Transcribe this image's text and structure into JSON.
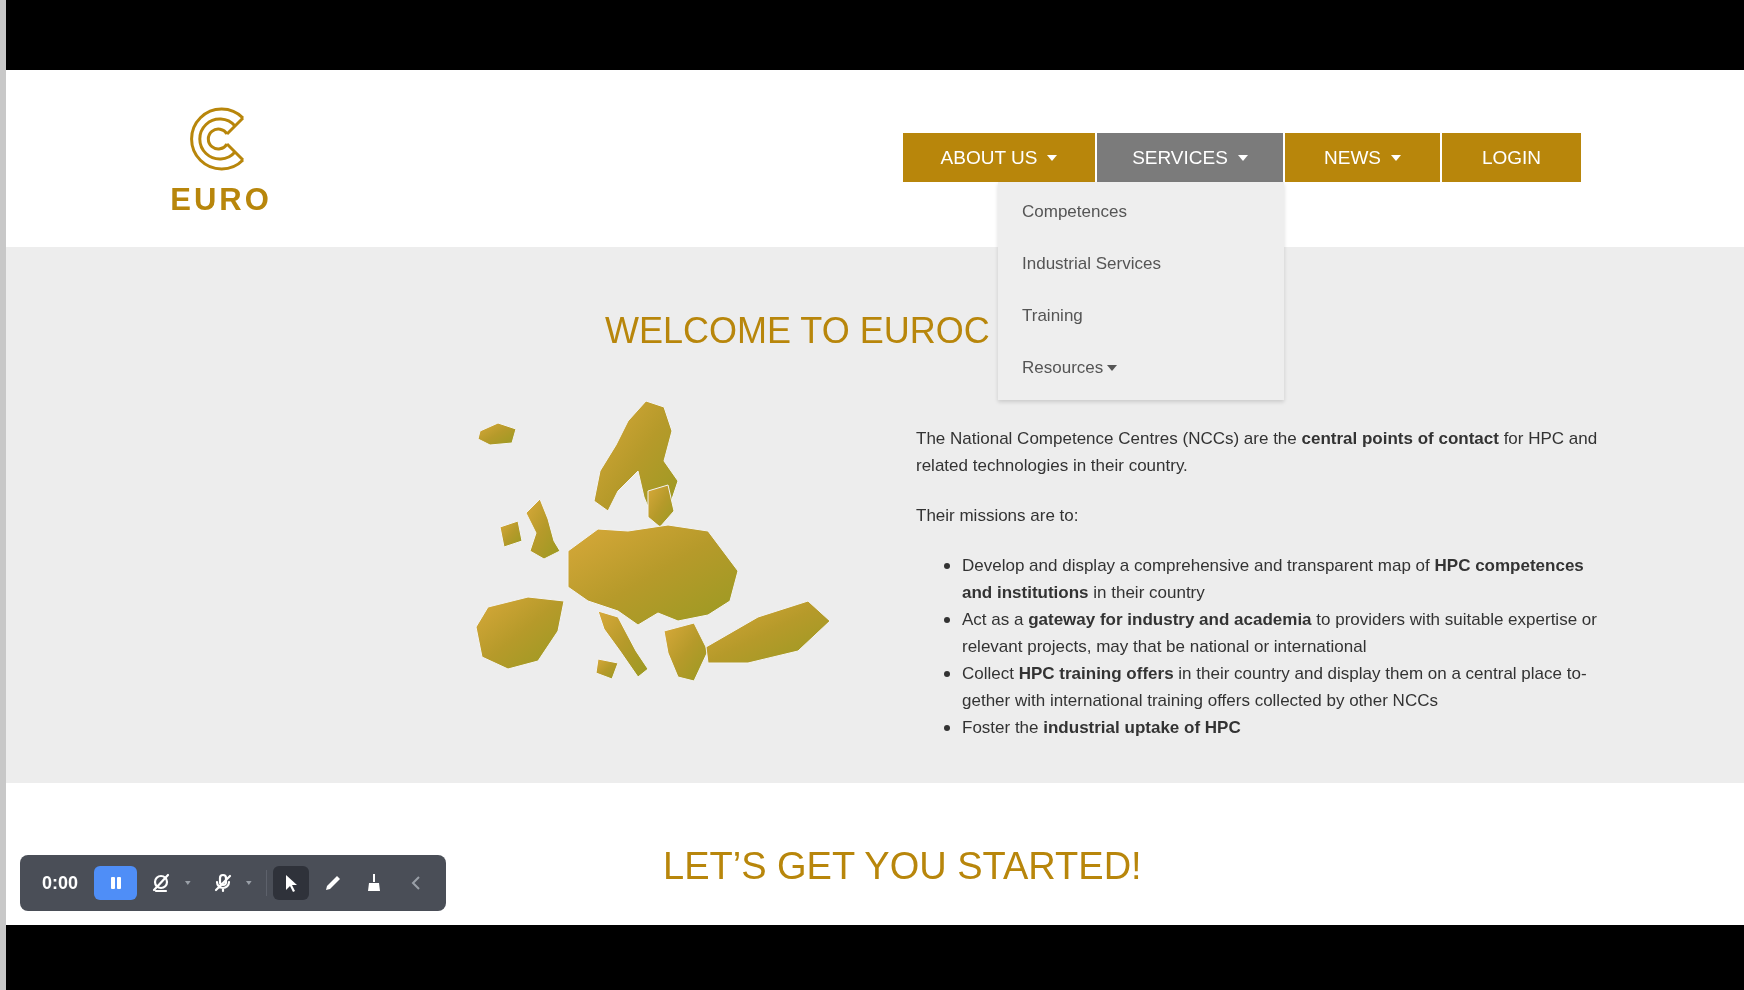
{
  "logo": {
    "text": "EURO"
  },
  "nav": [
    {
      "label": "ABOUT US",
      "dropdown": true,
      "selected": false
    },
    {
      "label": "SERVICES",
      "dropdown": true,
      "selected": true
    },
    {
      "label": "NEWS",
      "dropdown": true,
      "selected": false
    },
    {
      "label": "LOGIN",
      "dropdown": false,
      "selected": false
    }
  ],
  "services_menu": [
    {
      "label": "Competences",
      "dropdown": false
    },
    {
      "label": "Industrial Services",
      "dropdown": false
    },
    {
      "label": "Training",
      "dropdown": false
    },
    {
      "label": "Resources",
      "dropdown": true
    }
  ],
  "welcome": {
    "heading": "WELCOME TO EUROC",
    "intro": "The National Competence Centres (NCCs) are the **central points of contact** for HPC and related technologies in their country.",
    "missions_intro": "Their missions are to:",
    "missions": [
      "Develop and display a comprehensive and transparent map of **HPC competences and institutions** in their country",
      "Act as a **gateway for industry and academia** to providers with suitable expertise or relevant projects, may that be national or international",
      "Collect **HPC training offers** in their country and display them on a central place to-gether with international training offers collected by other NCCs",
      "Foster the **industrial uptake of HPC**"
    ]
  },
  "started": {
    "heading": "LET’S GET YOU STARTED!"
  },
  "recorder": {
    "timer": "0:00",
    "tools": [
      {
        "kind": "pause",
        "selected": true
      },
      {
        "kind": "camera-off",
        "selected": false
      },
      {
        "kind": "mic-off",
        "selected": false
      },
      {
        "kind": "pointer",
        "selected": true
      },
      {
        "kind": "pen",
        "selected": false
      },
      {
        "kind": "broom",
        "selected": false
      },
      {
        "kind": "collapse",
        "selected": false
      }
    ]
  }
}
